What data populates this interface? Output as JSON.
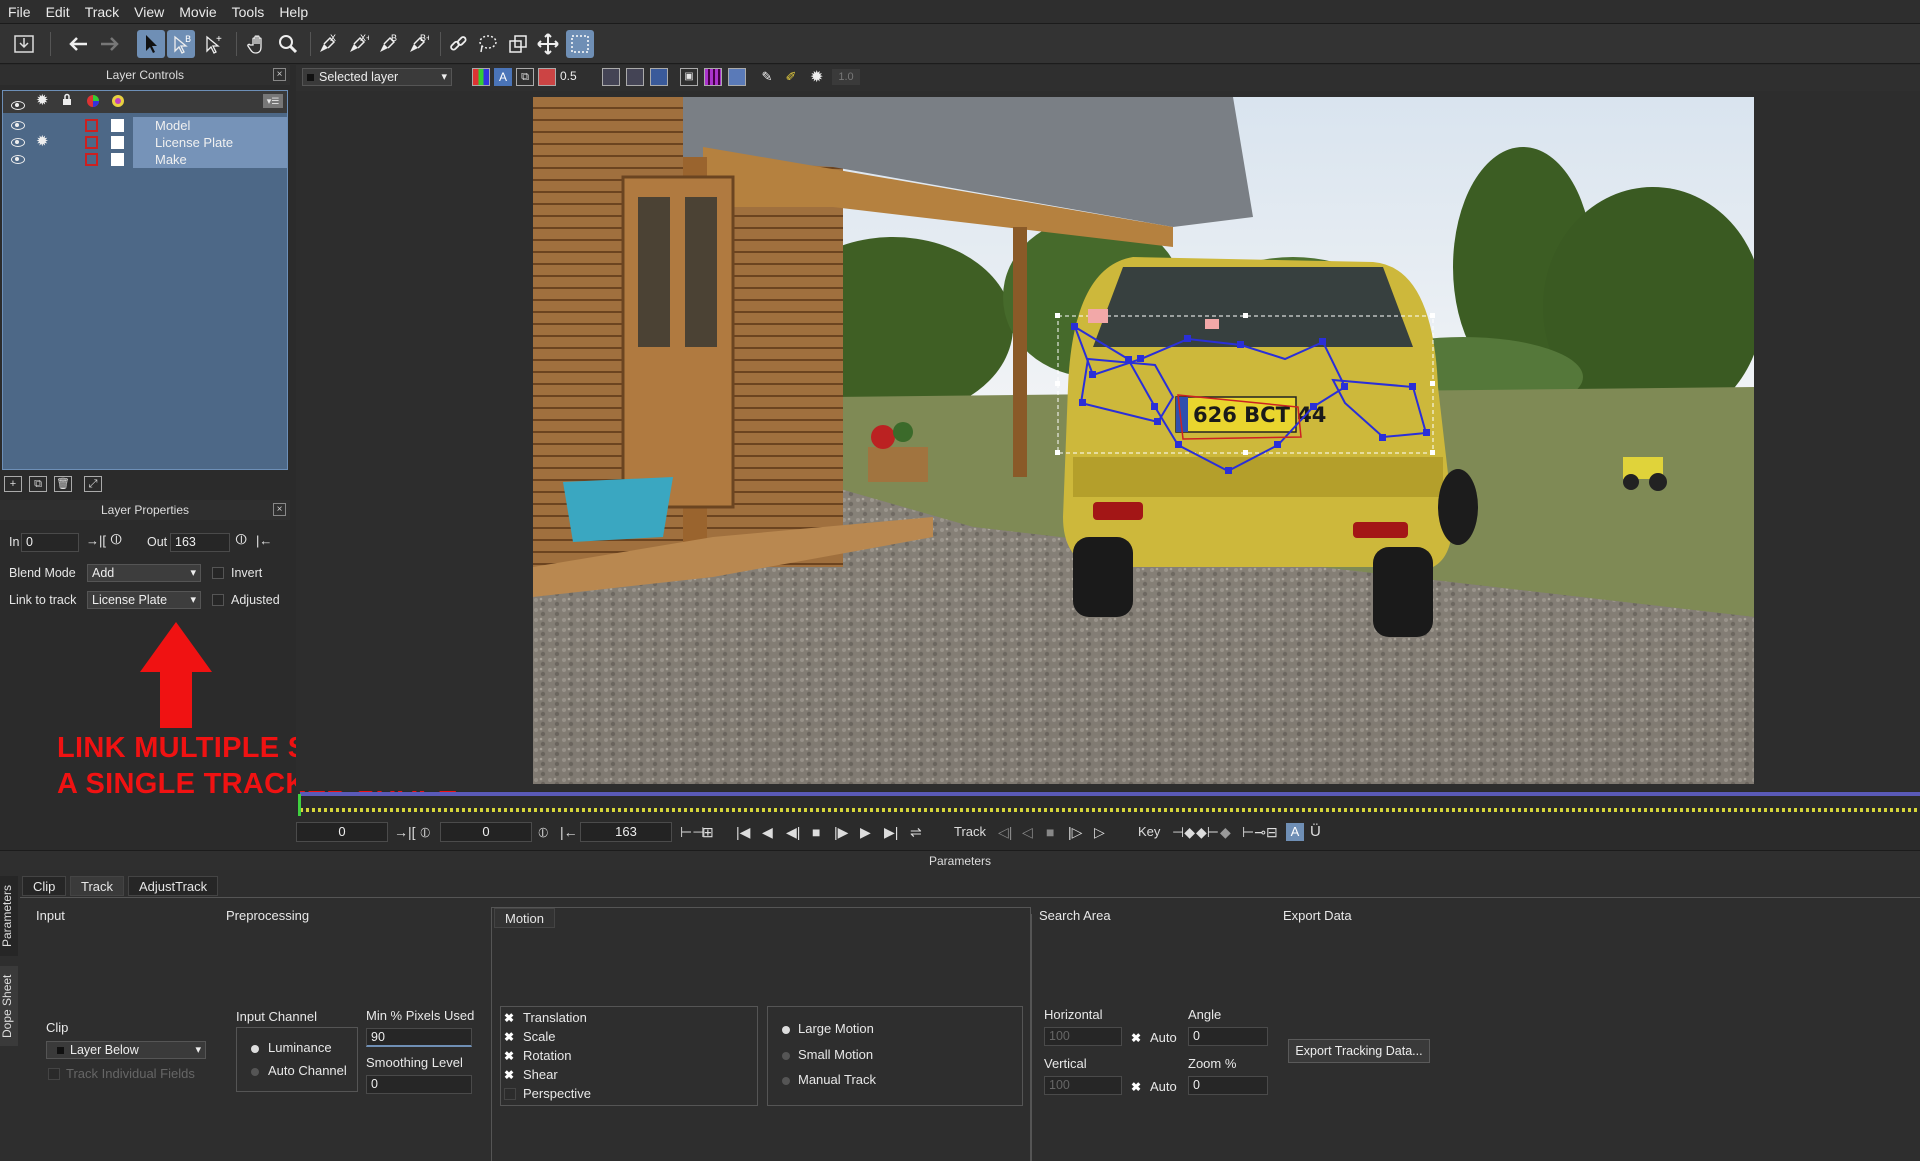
{
  "menu": [
    "File",
    "Edit",
    "Track",
    "View",
    "Movie",
    "Tools",
    "Help"
  ],
  "viewer_toolbar": {
    "layer_select": "Selected layer",
    "opacity_value": "0.5",
    "exposure_value": "1.0"
  },
  "layer_controls": {
    "title": "Layer Controls",
    "layers": [
      {
        "name": "Model"
      },
      {
        "name": "License Plate"
      },
      {
        "name": "Make"
      }
    ]
  },
  "layer_properties": {
    "title": "Layer Properties",
    "in_label": "In",
    "in_value": "0",
    "out_label": "Out",
    "out_value": "163",
    "blend_mode_label": "Blend Mode",
    "blend_mode_value": "Add",
    "invert_label": "Invert",
    "link_label": "Link to track",
    "link_value": "License Plate",
    "adjusted_label": "Adjusted"
  },
  "annotation": {
    "line1": "LINK MULTIPLE SHAPES TO",
    "line2": "A SINGLE TRACKED SHAPE"
  },
  "image": {
    "license_plate_text": "626 BCT 44"
  },
  "transport": {
    "in_frame": "0",
    "current_frame": "0",
    "out_frame": "163",
    "track_label": "Track",
    "key_label": "Key"
  },
  "parameters": {
    "title": "Parameters",
    "side_tabs": [
      "Parameters",
      "Dope Sheet"
    ],
    "tabs": [
      "Clip",
      "Track",
      "AdjustTrack"
    ],
    "input": {
      "title": "Input",
      "clip_label": "Clip",
      "clip_value": "Layer Below",
      "track_fields_label": "Track Individual Fields"
    },
    "preprocessing": {
      "title": "Preprocessing",
      "input_channel_label": "Input Channel",
      "luminance": "Luminance",
      "auto_channel": "Auto Channel",
      "min_pixels_label": "Min % Pixels Used",
      "min_pixels_value": "90",
      "smoothing_label": "Smoothing Level",
      "smoothing_value": "0"
    },
    "motion": {
      "title": "Motion",
      "options": [
        "Translation",
        "Scale",
        "Rotation",
        "Shear",
        "Perspective"
      ],
      "modes": [
        "Large Motion",
        "Small Motion",
        "Manual Track"
      ]
    },
    "search_area": {
      "title": "Search Area",
      "horizontal_label": "Horizontal",
      "horizontal_value": "100",
      "vertical_label": "Vertical",
      "vertical_value": "100",
      "auto_label": "Auto",
      "angle_label": "Angle",
      "angle_value": "0",
      "zoom_label": "Zoom %",
      "zoom_value": "0"
    },
    "export_data": {
      "title": "Export Data",
      "button": "Export Tracking Data..."
    }
  }
}
